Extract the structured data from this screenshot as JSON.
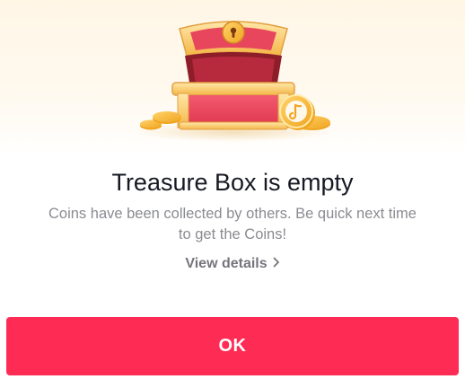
{
  "dialog": {
    "illustration": "treasure-chest-icon",
    "title": "Treasure Box is empty",
    "message": "Coins have been collected by others. Be quick next time to get the Coins!",
    "details_label": "View details",
    "details_icon": "chevron-right-icon",
    "ok_label": "OK"
  },
  "colors": {
    "accent": "#fe2c55",
    "title_text": "#161823",
    "secondary_text": "#8a8b91",
    "link_text": "#75767c"
  }
}
